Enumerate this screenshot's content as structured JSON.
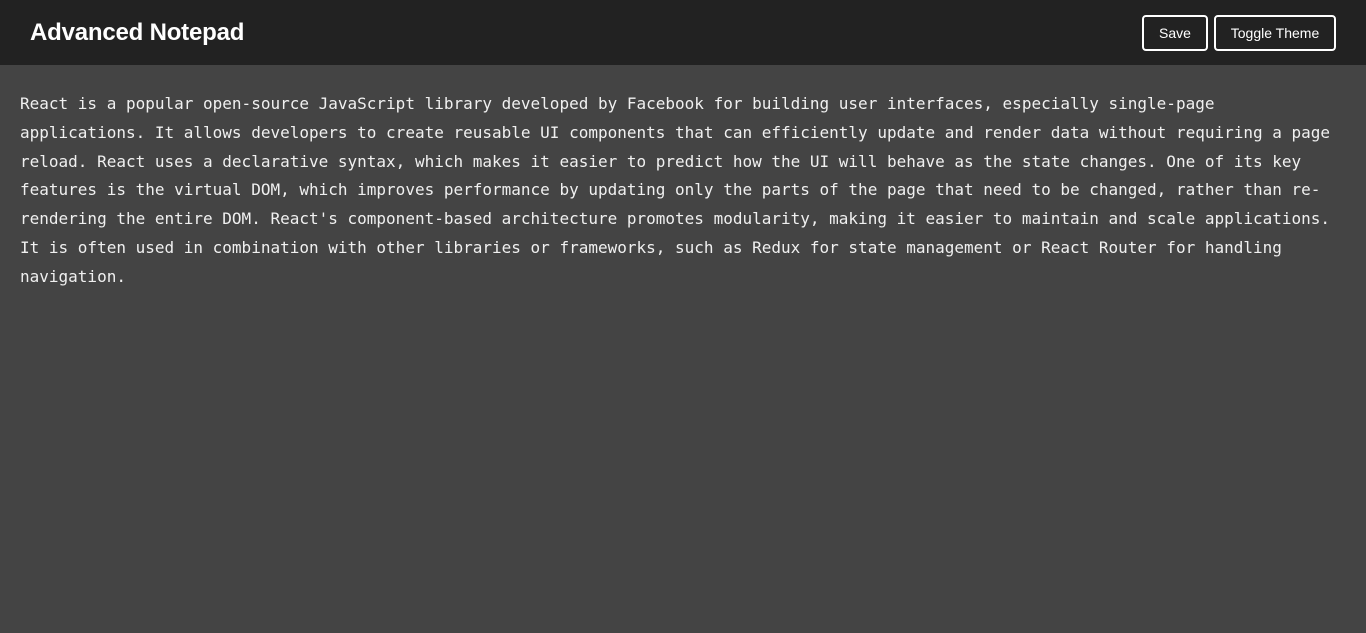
{
  "header": {
    "title": "Advanced Notepad",
    "save_label": "Save",
    "toggle_theme_label": "Toggle Theme"
  },
  "editor": {
    "content": "React is a popular open-source JavaScript library developed by Facebook for building user interfaces, especially single-page applications. It allows developers to create reusable UI components that can efficiently update and render data without requiring a page reload. React uses a declarative syntax, which makes it easier to predict how the UI will behave as the state changes. One of its key features is the virtual DOM, which improves performance by updating only the parts of the page that need to be changed, rather than re-rendering the entire DOM. React's component-based architecture promotes modularity, making it easier to maintain and scale applications. It is often used in combination with other libraries or frameworks, such as Redux for state management or React Router for handling navigation."
  },
  "colors": {
    "header_bg": "#222222",
    "editor_bg": "#444444",
    "text": "#f0f0f0",
    "button_border": "#ffffff"
  }
}
